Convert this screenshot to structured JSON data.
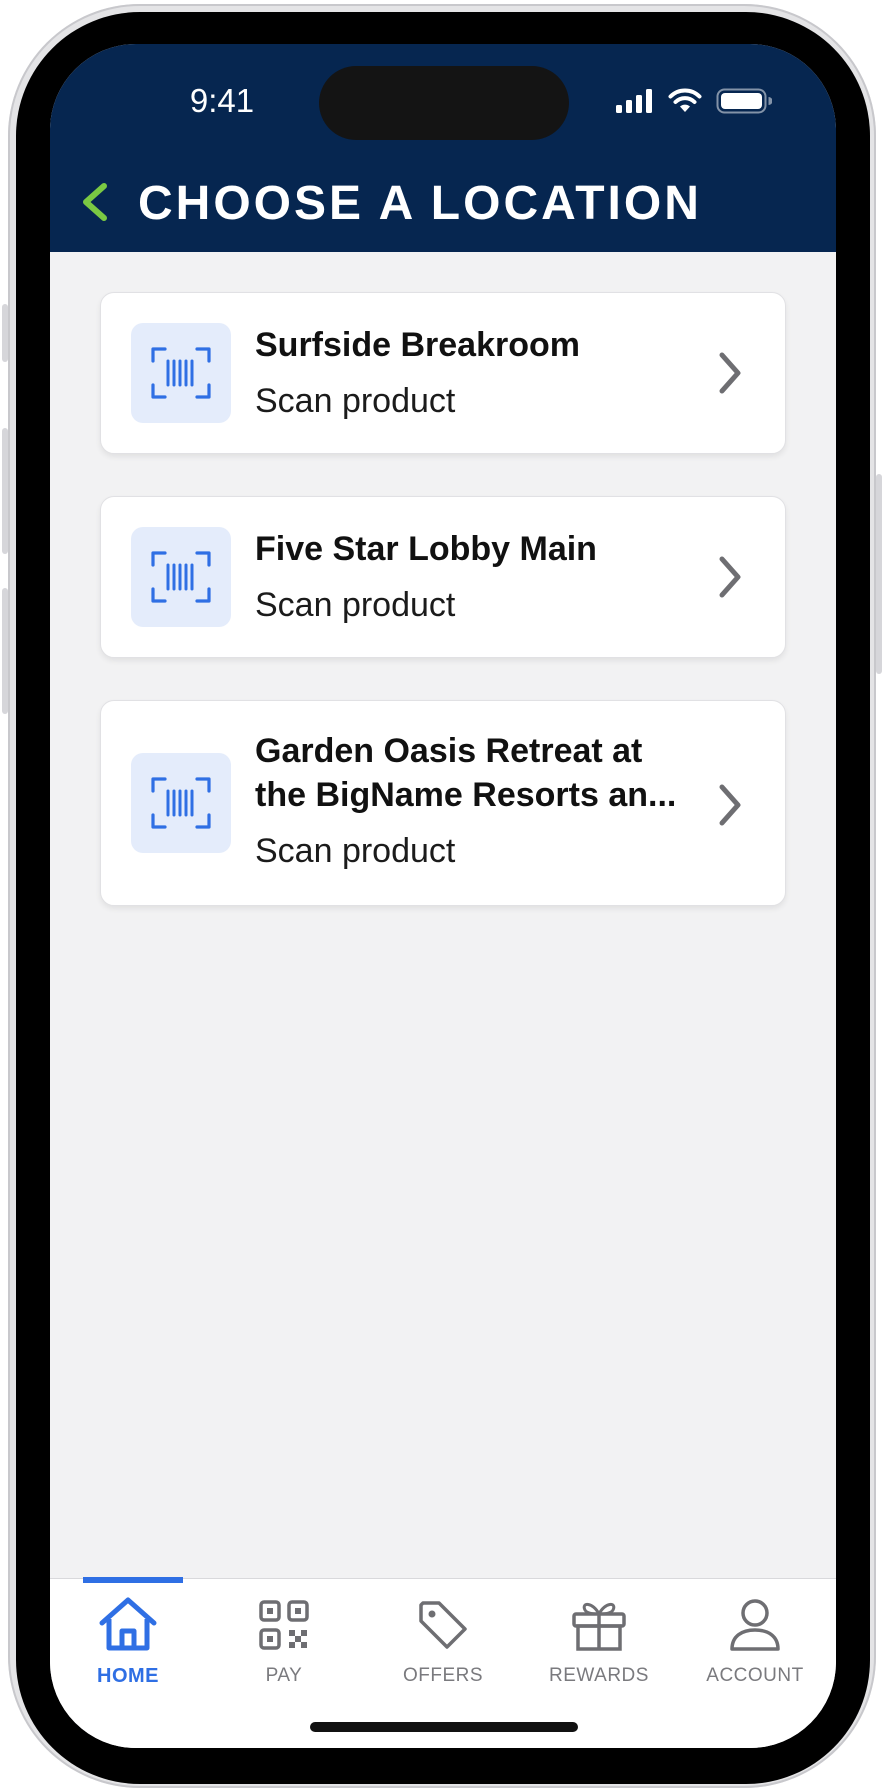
{
  "status_bar": {
    "time": "9:41"
  },
  "header": {
    "title": "CHOOSE A LOCATION",
    "back_icon": "chevron-left-icon"
  },
  "colors": {
    "header_bg": "#062650",
    "accent": "#2f6fe4",
    "back_arrow": "#7ac943"
  },
  "locations": [
    {
      "name": "Surfside Breakroom",
      "subtitle": "Scan product",
      "icon": "barcode-scan-icon"
    },
    {
      "name": "Five Star Lobby Main",
      "subtitle": "Scan product",
      "icon": "barcode-scan-icon"
    },
    {
      "name": "Garden Oasis Retreat at the BigName Resorts an...",
      "subtitle": "Scan product",
      "icon": "barcode-scan-icon"
    }
  ],
  "tabbar": {
    "items": [
      {
        "label": "HOME",
        "icon": "home-icon",
        "active": true
      },
      {
        "label": "PAY",
        "icon": "qr-code-icon",
        "active": false
      },
      {
        "label": "OFFERS",
        "icon": "tag-icon",
        "active": false
      },
      {
        "label": "REWARDS",
        "icon": "gift-icon",
        "active": false
      },
      {
        "label": "ACCOUNT",
        "icon": "user-icon",
        "active": false
      }
    ]
  }
}
